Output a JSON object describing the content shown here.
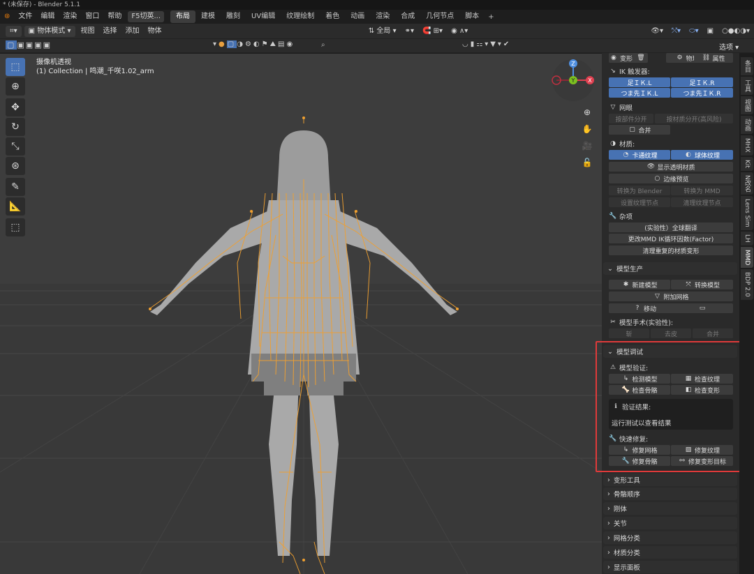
{
  "title_bar": {
    "text": "* (未保存) - Blender 5.1.1"
  },
  "menu": {
    "items": [
      "文件",
      "编辑",
      "渲染",
      "窗口",
      "帮助"
    ],
    "f5_button": "F5切英...",
    "workspaces": [
      "布局",
      "建模",
      "雕刻",
      "UV编辑",
      "纹理绘制",
      "着色",
      "动画",
      "渲染",
      "合成",
      "几何节点",
      "脚本"
    ],
    "active_workspace": "布局",
    "add_workspace": "+"
  },
  "header": {
    "mode": "物体模式",
    "menus": [
      "视图",
      "选择",
      "添加",
      "物体"
    ],
    "transform_orientation": "全局"
  },
  "subheader": {
    "search_placeholder": "搜索",
    "options_label": "选项"
  },
  "viewport": {
    "view_label": "摄像机透视",
    "collection_label": "(1) Collection | 鸣潮_千咲1.02_arm",
    "gizmo_z": "Z",
    "gizmo_y": "Y",
    "gizmo_x": "X"
  },
  "side_tabs": [
    "条目",
    "工具",
    "视图",
    "动画",
    "MHX",
    "Kit",
    "N改名",
    "Lens Sim",
    "LH",
    "MMD",
    "BDP 2.0"
  ],
  "active_side_tab": "MMD",
  "panel": {
    "top_row": {
      "shape_key": "变形",
      "physics": "物理",
      "property": "属性"
    },
    "ik_toggle": {
      "label": "IK 触发器:",
      "buttons": [
        "足ＩＫ.L",
        "足ＩＫ.R",
        "つま先ＩＫ.L",
        "つま先ＩＫ.R"
      ]
    },
    "mesh": {
      "label": "网眼",
      "separate_by_part": "按部件分开",
      "separate_by_material": "按材质分开(高风险)",
      "join": "合并"
    },
    "material": {
      "label": "材质:",
      "toon_texture": "卡通纹理",
      "sphere_texture": "球体纹理",
      "show_transparent": "显示透明材质",
      "edge_preview": "边缘预览",
      "convert_blender": "转换为 Blender",
      "convert_mmd": "转换为 MMD",
      "setup_texture_nodes": "设置纹理节点",
      "clean_texture_nodes": "清理纹理节点"
    },
    "misc": {
      "label": "杂项",
      "translate": "(实验性）全球翻译",
      "ik_loop": "更改MMD IK循环因数(Factor)",
      "clean_morphs": "清理重复的材质变形"
    },
    "model_production": {
      "title": "模型生产",
      "new_model": "新建模型",
      "convert_model": "转换模型",
      "attach_meshes": "附加网格",
      "move": "移动",
      "surgery_label": "模型手术(实验性):",
      "chop": "斩",
      "peel": "去皮",
      "merge": "合并"
    },
    "model_debug": {
      "title": "模型调试",
      "validation_label": "模型验证:",
      "check_model": "检测模型",
      "check_texture": "检查纹理",
      "check_bones": "检查骨骼",
      "check_morphs": "检查变形",
      "result_label": "验证结果:",
      "result_text": "运行测试以查看结果",
      "quickfix_label": "快速修复:",
      "fix_mesh": "修复网格",
      "fix_texture": "修复纹理",
      "fix_bones": "修复骨骼",
      "fix_morphs": "修复变形目标"
    },
    "collapsed_sections": [
      "变形工具",
      "骨骼顺序",
      "刚体",
      "关节",
      "网格分类",
      "材质分类",
      "显示面板"
    ]
  },
  "colors": {
    "accent_blue": "#4772b3",
    "highlight_red": "#e03a3a",
    "armature_orange": "#f0a030"
  }
}
